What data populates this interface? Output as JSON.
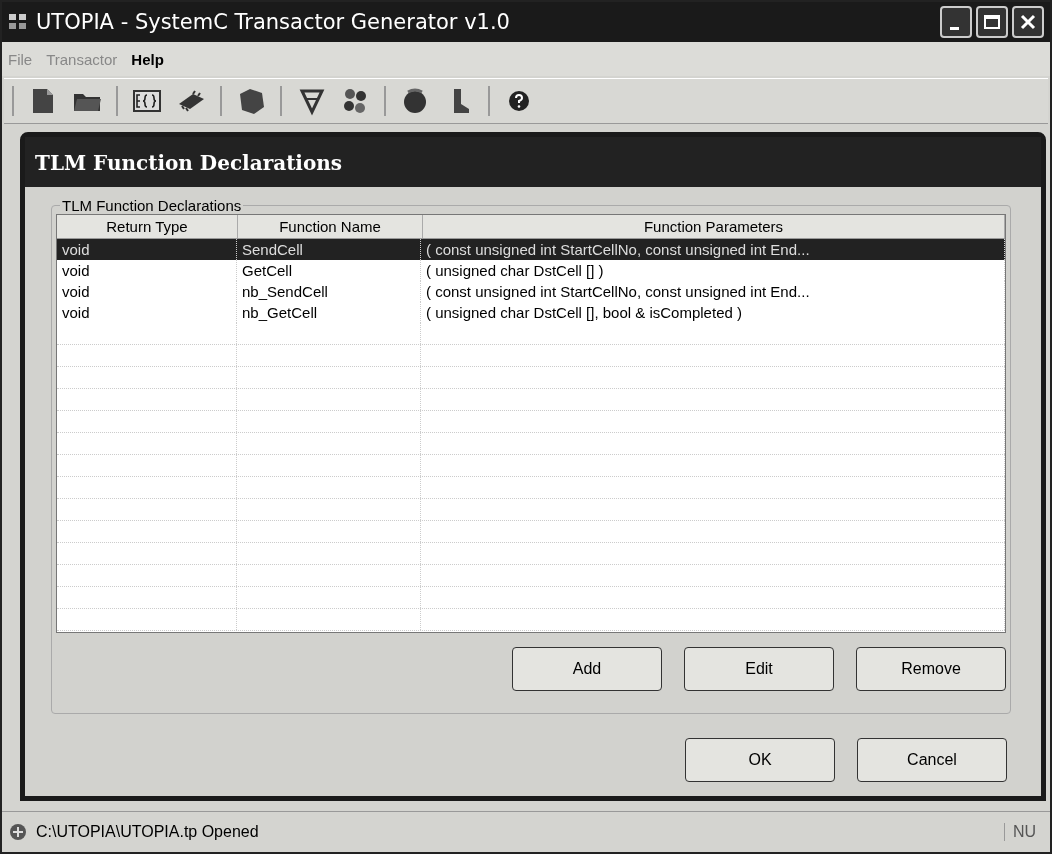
{
  "window": {
    "title": "UTOPIA - SystemC Transactor Generator v1.0"
  },
  "menu": [
    {
      "label": "File",
      "disabled": true
    },
    {
      "label": "Transactor",
      "disabled": true
    },
    {
      "label": "Help",
      "disabled": false
    }
  ],
  "dialog": {
    "title": "TLM Function Declarations",
    "group_label": "TLM Function Declarations",
    "table": {
      "columns": [
        "Return Type",
        "Function Name",
        "Function Parameters"
      ],
      "rows": [
        {
          "cells": [
            "void",
            "SendCell",
            "( const unsigned int  StartCellNo, const unsigned int  End..."
          ],
          "selected": true
        },
        {
          "cells": [
            "void",
            "GetCell",
            "( unsigned char  DstCell [] )"
          ],
          "selected": false
        },
        {
          "cells": [
            "void",
            "nb_SendCell",
            "( const unsigned int  StartCellNo, const unsigned int  End..."
          ],
          "selected": false
        },
        {
          "cells": [
            "void",
            "nb_GetCell",
            "( unsigned char  DstCell [], bool & isCompleted )"
          ],
          "selected": false
        }
      ]
    },
    "table_buttons": [
      "Add",
      "Edit",
      "Remove"
    ],
    "buttons": [
      "OK",
      "Cancel"
    ]
  },
  "status_bar": {
    "message": "C:\\UTOPIA\\UTOPIA.tp Opened",
    "indicator": "NU"
  }
}
